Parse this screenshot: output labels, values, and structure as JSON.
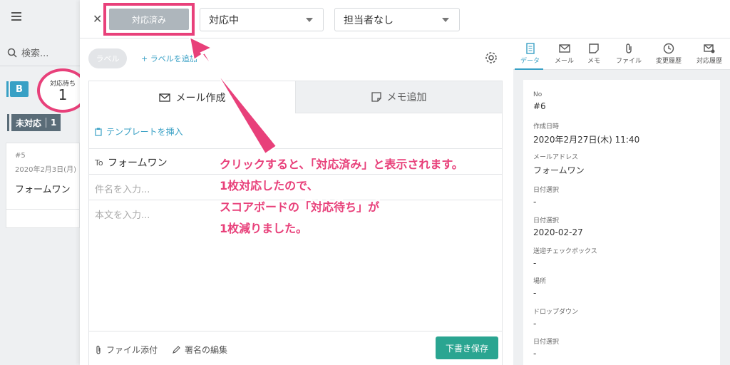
{
  "left": {
    "search_placeholder": "検索...",
    "b_tag": "B",
    "waiting_label": "対応待ち",
    "waiting_count": "1",
    "unhandled_label": "未対応",
    "unhandled_count": "1",
    "card": {
      "no": "#5",
      "date": "2020年2月3日(月)",
      "name": "フォームワン"
    }
  },
  "topbar": {
    "status_button": "対応済み",
    "status_select": "対応中",
    "assignee_select": "担当者なし"
  },
  "labels": {
    "pill": "ラベル",
    "add": "+ ラベルを追加"
  },
  "tabs": {
    "compose": "メール作成",
    "memo": "メモ追加"
  },
  "compose": {
    "insert_template": "テンプレートを挿入",
    "to_label": "To",
    "to_value": "フォームワン",
    "subject_placeholder": "件名を入力...",
    "body_placeholder": "本文を入力...",
    "attach": "ファイル添付",
    "signature": "署名の編集",
    "save_draft": "下書き保存"
  },
  "annotation": {
    "line1": "クリックすると、「対応済み」と表示されます。",
    "line2": "1枚対応したので、",
    "line3": "スコアボードの「対応待ち」が",
    "line4": "1枚減りました。"
  },
  "right_tabs": [
    "データ",
    "メール",
    "メモ",
    "ファイル",
    "変更履歴",
    "対応履歴"
  ],
  "fields": [
    {
      "k": "No",
      "v": "#6"
    },
    {
      "k": "作成日時",
      "v": "2020年2月27日(木) 11:40"
    },
    {
      "k": "メールアドレス",
      "v": "フォームワン"
    },
    {
      "k": "日付選択",
      "v": "-"
    },
    {
      "k": "日付選択",
      "v": "2020-02-27"
    },
    {
      "k": "送迎チェックボックス",
      "v": "-"
    },
    {
      "k": "場所",
      "v": "-"
    },
    {
      "k": "ドロップダウン",
      "v": "-"
    },
    {
      "k": "日付選択",
      "v": "-"
    }
  ],
  "colors": {
    "highlight": "#e8407a",
    "accent": "#38a0c5",
    "save": "#2aa591"
  }
}
